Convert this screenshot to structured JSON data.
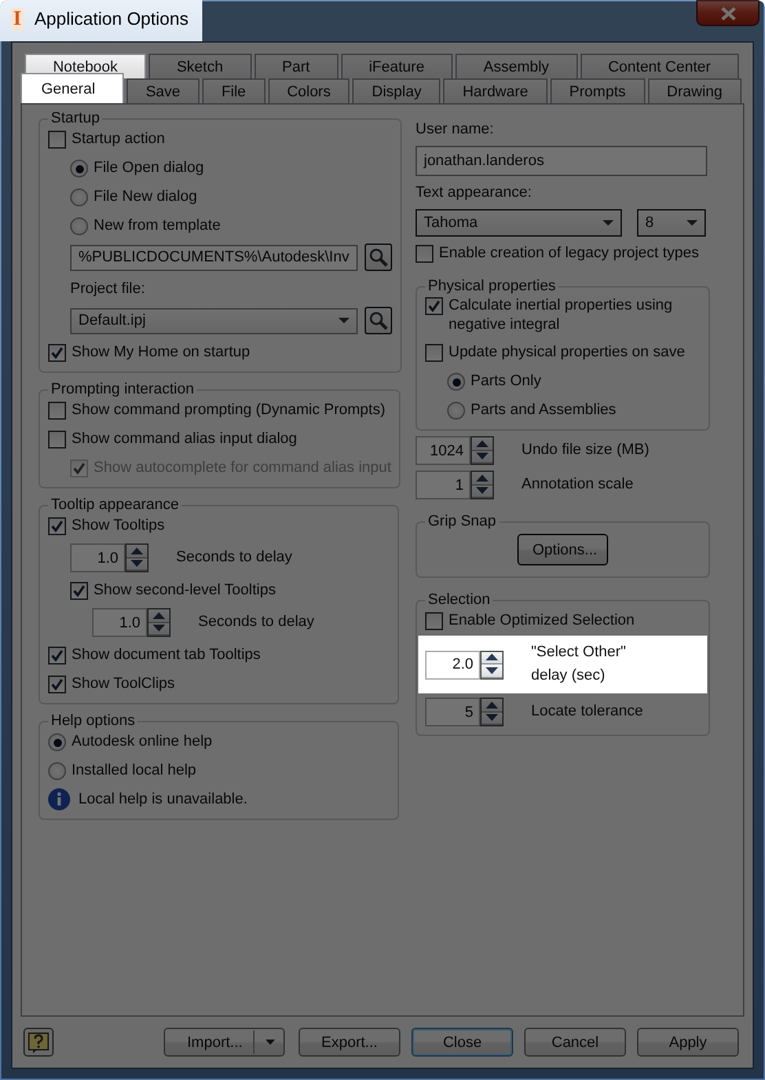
{
  "window": {
    "icon_letter": "I",
    "title": "Application Options",
    "highlighted": true
  },
  "tab_rows": [
    {
      "tabs": [
        {
          "label": "Notebook",
          "selected": false,
          "highlighted": true
        },
        {
          "label": "Sketch",
          "selected": false,
          "highlighted": false
        },
        {
          "label": "Part",
          "selected": false,
          "highlighted": false
        },
        {
          "label": "iFeature",
          "selected": false,
          "highlighted": false
        },
        {
          "label": "Assembly",
          "selected": false,
          "highlighted": false
        },
        {
          "label": "Content Center",
          "selected": false,
          "highlighted": false
        }
      ]
    },
    {
      "tabs": [
        {
          "label": "General",
          "selected": true,
          "highlighted": true
        },
        {
          "label": "Save",
          "selected": false,
          "highlighted": false
        },
        {
          "label": "File",
          "selected": false,
          "highlighted": false
        },
        {
          "label": "Colors",
          "selected": false,
          "highlighted": false
        },
        {
          "label": "Display",
          "selected": false,
          "highlighted": false
        },
        {
          "label": "Hardware",
          "selected": false,
          "highlighted": false
        },
        {
          "label": "Prompts",
          "selected": false,
          "highlighted": false
        },
        {
          "label": "Drawing",
          "selected": false,
          "highlighted": false
        }
      ]
    }
  ],
  "left_groups": [
    {
      "title": "Startup",
      "items": [
        {
          "kind": "checkbox",
          "label": "Startup action",
          "checked": false,
          "children": [
            {
              "kind": "radio",
              "label": "File Open dialog",
              "selected": true
            },
            {
              "kind": "radio",
              "label": "File New dialog",
              "selected": false
            },
            {
              "kind": "radio",
              "label": "New from template",
              "selected": false
            },
            {
              "kind": "path_field",
              "value": "%PUBLICDOCUMENTS%\\Autodesk\\Inv"
            },
            {
              "kind": "label",
              "label": "Project file:"
            },
            {
              "kind": "dropdown",
              "value": "Default.ipj"
            }
          ]
        },
        {
          "kind": "checkbox",
          "label": "Show My Home on startup",
          "checked": true
        }
      ]
    },
    {
      "title": "Prompting interaction",
      "items": [
        {
          "kind": "checkbox",
          "label": "Show command prompting (Dynamic Prompts)",
          "checked": false
        },
        {
          "kind": "checkbox",
          "label": "Show command alias input dialog",
          "checked": false,
          "children": [
            {
              "kind": "checkbox",
              "label": "Show autocomplete for command alias input",
              "checked": true,
              "disabled": true
            }
          ]
        }
      ]
    },
    {
      "title": "Tooltip appearance",
      "items": [
        {
          "kind": "checkbox",
          "label": "Show Tooltips",
          "checked": true,
          "children": [
            {
              "kind": "spinner",
              "value": "1.0",
              "label_lines": [
                "Seconds to delay"
              ]
            },
            {
              "kind": "checkbox",
              "label": "Show second-level Tooltips",
              "checked": true,
              "children": [
                {
                  "kind": "spinner",
                  "value": "1.0",
                  "label_lines": [
                    "Seconds to delay"
                  ]
                }
              ]
            }
          ]
        },
        {
          "kind": "checkbox",
          "label": "Show document tab Tooltips",
          "checked": true
        },
        {
          "kind": "checkbox",
          "label": "Show ToolClips",
          "checked": true
        }
      ]
    },
    {
      "title": "Help options",
      "items": [
        {
          "kind": "radio",
          "label": "Autodesk online help",
          "selected": true
        },
        {
          "kind": "radio",
          "label": "Installed local help",
          "selected": false
        },
        {
          "kind": "info",
          "label": "Local help is unavailable."
        }
      ]
    }
  ],
  "right_items": [
    {
      "kind": "label",
      "label": "User name:"
    },
    {
      "kind": "text_field",
      "value": "jonathan.landeros"
    },
    {
      "kind": "label",
      "label": "Text appearance:"
    },
    {
      "kind": "font_row",
      "font": "Tahoma",
      "size": "8"
    },
    {
      "kind": "checkbox",
      "label": "Enable creation of legacy project types",
      "checked": false
    },
    {
      "kind": "group",
      "title": "Physical properties",
      "items": [
        {
          "kind": "checkbox",
          "label": "Calculate inertial properties using negative integral",
          "checked": true
        },
        {
          "kind": "checkbox",
          "label": "Update physical properties on save",
          "checked": false,
          "children": [
            {
              "kind": "radio",
              "label": "Parts Only",
              "selected": true
            },
            {
              "kind": "radio",
              "label": "Parts and Assemblies",
              "selected": false
            }
          ]
        }
      ]
    },
    {
      "kind": "spinner",
      "value": "1024",
      "label_lines": [
        "Undo file size (MB)"
      ]
    },
    {
      "kind": "spinner",
      "value": "1",
      "label_lines": [
        "Annotation scale"
      ]
    },
    {
      "kind": "group",
      "title": "Grip Snap",
      "items": [
        {
          "kind": "button",
          "label": "Options..."
        }
      ]
    },
    {
      "kind": "group",
      "title": "Selection",
      "items": [
        {
          "kind": "checkbox",
          "label": "Enable Optimized Selection",
          "checked": false
        },
        {
          "kind": "spinner",
          "value": "2.0",
          "label_lines": [
            "\"Select Other\"",
            "delay (sec)"
          ],
          "highlighted": true
        },
        {
          "kind": "spinner",
          "value": "5",
          "label_lines": [
            "Locate tolerance"
          ]
        }
      ]
    }
  ],
  "footer_buttons": [
    {
      "label": "Import...",
      "kind": "split"
    },
    {
      "label": "Export...",
      "kind": "plain"
    },
    {
      "label": "Close",
      "kind": "default"
    },
    {
      "label": "Cancel",
      "kind": "plain"
    },
    {
      "label": "Apply",
      "kind": "plain"
    }
  ]
}
